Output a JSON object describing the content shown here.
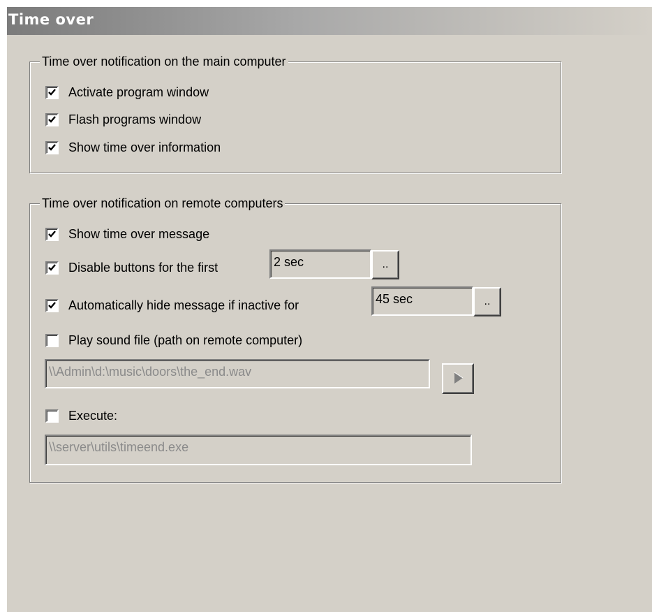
{
  "header": {
    "title": "Time over"
  },
  "main_group": {
    "label": "Time over notification on the main computer",
    "items": [
      {
        "label": "Activate program window",
        "checked": true
      },
      {
        "label": "Flash programs window",
        "checked": true
      },
      {
        "label": "Show time over information",
        "checked": true
      }
    ]
  },
  "remote_group": {
    "label": "Time over notification on remote computers",
    "show_message": {
      "label": "Show time over message",
      "checked": true
    },
    "disable_buttons": {
      "label": "Disable buttons for the first",
      "checked": true,
      "value": "2 sec",
      "browse_label": ".."
    },
    "auto_hide": {
      "label": "Automatically hide message if inactive for",
      "checked": true,
      "value": "45 sec",
      "browse_label": ".."
    },
    "play_sound": {
      "label": "Play sound file (path on remote computer)",
      "checked": false,
      "path": "\\\\Admin\\d:\\music\\doors\\the_end.wav"
    },
    "execute": {
      "label": "Execute:",
      "checked": false,
      "path": "\\\\server\\utils\\timeend.exe"
    }
  },
  "colors": {
    "panel_bg": "#d4d0c8",
    "disabled_text": "#8a8a8a"
  }
}
